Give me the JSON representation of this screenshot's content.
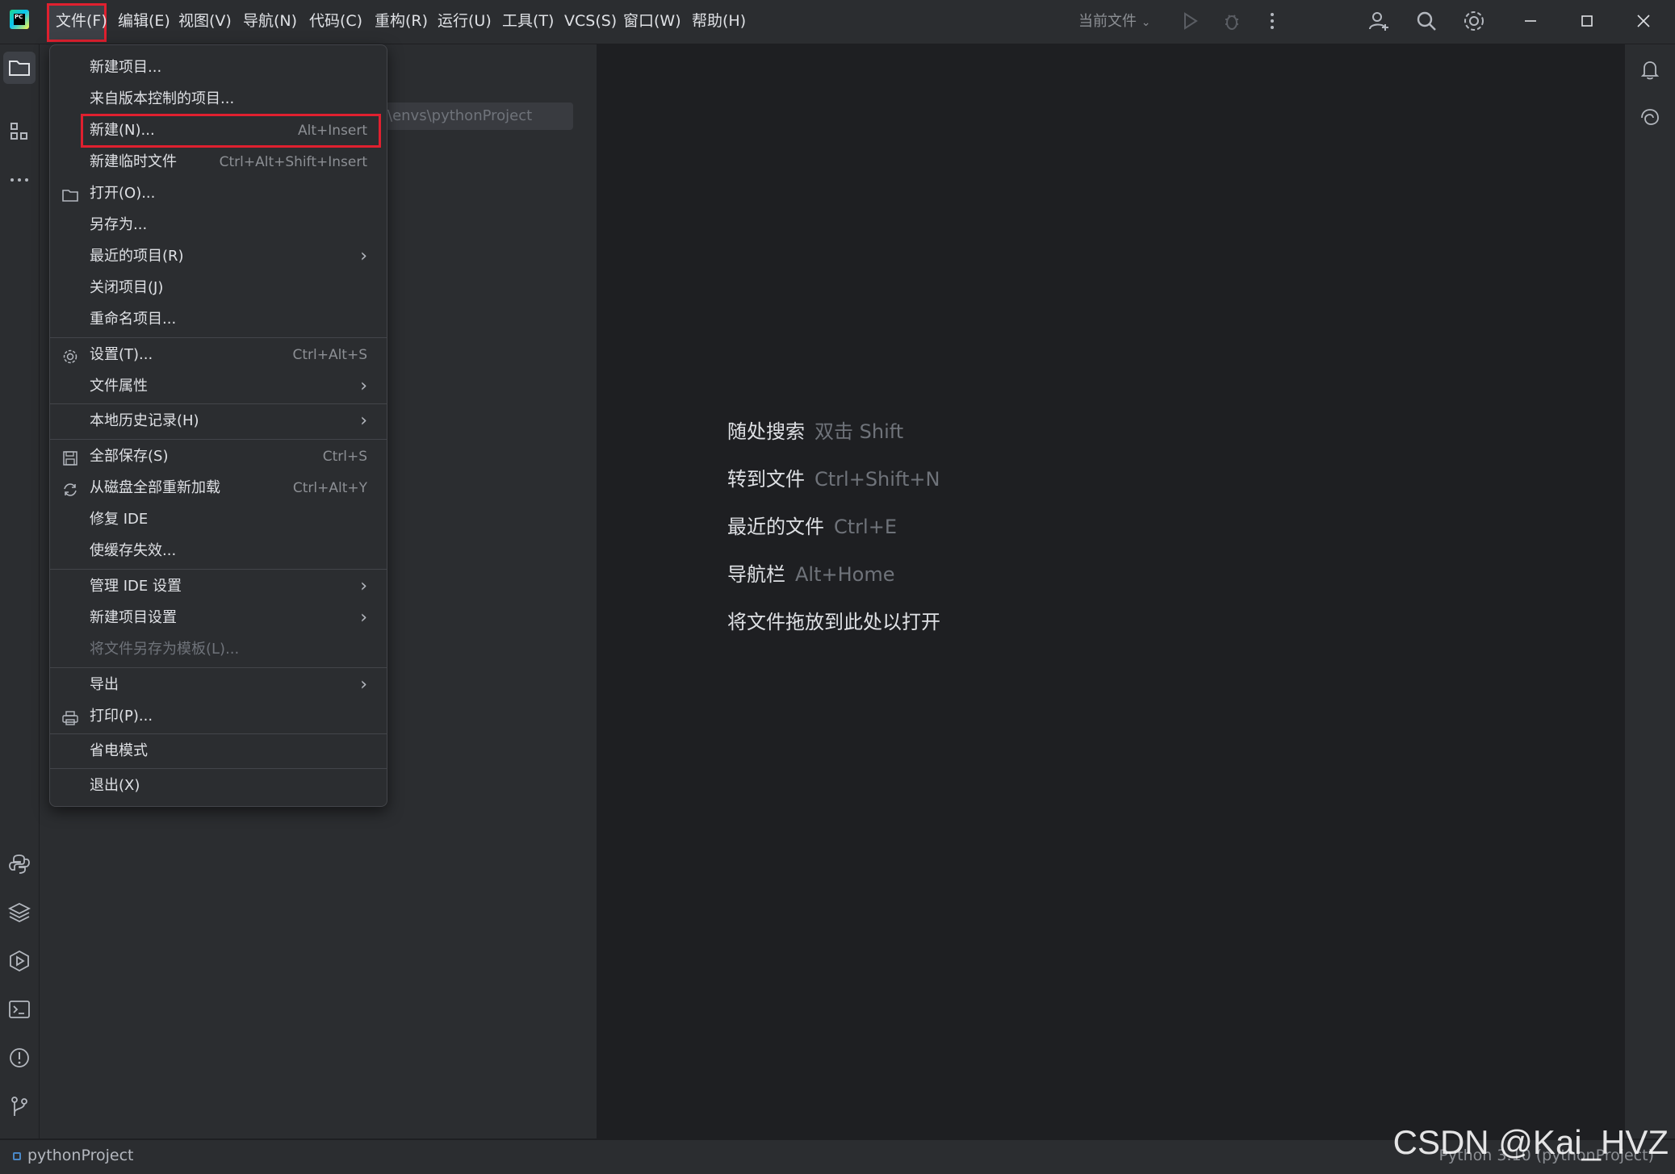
{
  "menubar": {
    "items": [
      "文件(F)",
      "编辑(E)",
      "视图(V)",
      "导航(N)",
      "代码(C)",
      "重构(R)",
      "运行(U)",
      "工具(T)",
      "VCS(S)",
      "窗口(W)",
      "帮助(H)"
    ],
    "run_config_label": "当前文件"
  },
  "project_panel": {
    "path_fragment": "\\envs\\pythonProject"
  },
  "file_menu": {
    "items": [
      {
        "label": "新建项目...",
        "shortcut": "",
        "submenu": false
      },
      {
        "label": "来自版本控制的项目...",
        "shortcut": "",
        "submenu": false
      },
      {
        "label": "新建(N)...",
        "shortcut": "Alt+Insert",
        "submenu": false
      },
      {
        "label": "新建临时文件",
        "shortcut": "Ctrl+Alt+Shift+Insert",
        "submenu": false
      },
      {
        "label": "打开(O)...",
        "shortcut": "",
        "submenu": false,
        "icon": "folder-icon"
      },
      {
        "label": "另存为...",
        "shortcut": "",
        "submenu": false
      },
      {
        "label": "最近的项目(R)",
        "shortcut": "",
        "submenu": true
      },
      {
        "label": "关闭项目(J)",
        "shortcut": "",
        "submenu": false
      },
      {
        "label": "重命名项目...",
        "shortcut": "",
        "submenu": false
      },
      {
        "label": "设置(T)...",
        "shortcut": "Ctrl+Alt+S",
        "submenu": false,
        "icon": "gear-icon"
      },
      {
        "label": "文件属性",
        "shortcut": "",
        "submenu": true
      },
      {
        "label": "本地历史记录(H)",
        "shortcut": "",
        "submenu": true
      },
      {
        "label": "全部保存(S)",
        "shortcut": "Ctrl+S",
        "submenu": false,
        "icon": "save-icon"
      },
      {
        "label": "从磁盘全部重新加载",
        "shortcut": "Ctrl+Alt+Y",
        "submenu": false,
        "icon": "reload-icon"
      },
      {
        "label": "修复 IDE",
        "shortcut": "",
        "submenu": false
      },
      {
        "label": "使缓存失效...",
        "shortcut": "",
        "submenu": false
      },
      {
        "label": "管理 IDE 设置",
        "shortcut": "",
        "submenu": true
      },
      {
        "label": "新建项目设置",
        "shortcut": "",
        "submenu": true
      },
      {
        "label": "将文件另存为模板(L)...",
        "shortcut": "",
        "submenu": false,
        "disabled": true
      },
      {
        "label": "导出",
        "shortcut": "",
        "submenu": true
      },
      {
        "label": "打印(P)...",
        "shortcut": "",
        "submenu": false,
        "icon": "print-icon"
      },
      {
        "label": "省电模式",
        "shortcut": "",
        "submenu": false
      },
      {
        "label": "退出(X)",
        "shortcut": "",
        "submenu": false
      }
    ]
  },
  "editor_hints": [
    {
      "label": "随处搜索",
      "key": "双击 Shift"
    },
    {
      "label": "转到文件",
      "key": "Ctrl+Shift+N"
    },
    {
      "label": "最近的文件",
      "key": "Ctrl+E"
    },
    {
      "label": "导航栏",
      "key": "Alt+Home"
    },
    {
      "label": "将文件拖放到此处以打开",
      "key": ""
    }
  ],
  "statusbar": {
    "project": "pythonProject",
    "interpreter": "Python 3.10 (pythonProject)"
  },
  "watermark": "CSDN @Kai_HVZ",
  "colors": {
    "highlight_border": "#e0202f",
    "background": "#1e1f22",
    "panel": "#2b2d30"
  }
}
